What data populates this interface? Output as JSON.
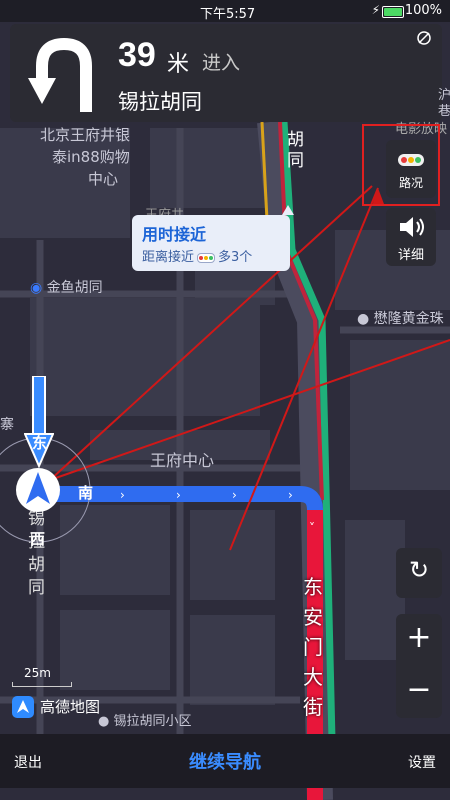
{
  "status_bar": {
    "time": "下午5:57",
    "battery": "100%"
  },
  "guidance": {
    "distance": "39",
    "unit": "米",
    "action": "进入",
    "road_name": "锡拉胡同"
  },
  "tip_card": {
    "title": "用时接近",
    "description_prefix": "距离接近",
    "description_suffix": "多3个"
  },
  "side_buttons": {
    "traffic_label": "路况",
    "detail_label": "详细"
  },
  "compass": {
    "north": "东",
    "east": "南",
    "south": "西"
  },
  "map_labels": {
    "mall_line1": "北京王府井银",
    "mall_line2": "泰in88购物",
    "mall_line3": "中心",
    "poi_top": "王府井",
    "jinyu": "金鱼胡同",
    "wangfu_center": "王府中心",
    "xila_v1": "锡",
    "xila_v2": "拉",
    "xila_v3": "胡",
    "xila_v4": "同",
    "dongan_v1": "东",
    "dongan_v2": "安",
    "dongan_v3": "门",
    "dongan_v4": "大",
    "dongan_v5": "街",
    "hutong_v1": "胡",
    "hutong_v2": "同",
    "mao_long": "懋隆黄金珠",
    "xila_community": "锡拉胡同小区",
    "top_right_v1": "沪",
    "top_right_v2": "巷",
    "top_right_h": "电影放映",
    "left_edge": "寨"
  },
  "scale": "25m",
  "brand": "高德地图",
  "bottom_bar": {
    "exit": "退出",
    "continue": "继续导航",
    "settings": "设置"
  },
  "colors": {
    "route_blue": "#2f6cf0",
    "route_red": "#e8163a",
    "route_green": "#1fb07a",
    "highlight": "#e02020"
  }
}
